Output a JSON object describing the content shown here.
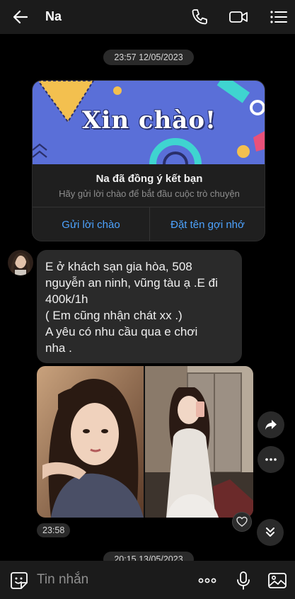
{
  "header": {
    "title": "Na",
    "icons": [
      "back-arrow-icon",
      "phone-icon",
      "video-call-icon",
      "menu-icon"
    ]
  },
  "timestamps": {
    "first": "23:57 12/05/2023",
    "second": "20:15 13/05/2023",
    "message_time": "23:58"
  },
  "friend_card": {
    "banner_text": "Xin chào!",
    "title": "Na đã đồng ý kết bạn",
    "subtitle": "Hãy gửi lời chào để bắt đầu cuộc trò chuyện",
    "send_greeting": "Gửi lời chào",
    "set_nickname": "Đặt tên gợi nhớ"
  },
  "message": {
    "lines": [
      " E ở khách sạn gia hòa, 508",
      "nguyễn an ninh, vũng tàu ạ .E đi",
      "400k/1h",
      "( Em cũng nhận chát xx .)",
      "A yêu có nhu cầu qua e chơi",
      "nha ."
    ]
  },
  "composer": {
    "placeholder": "Tin nhắn"
  },
  "colors": {
    "accent": "#4da3ff",
    "background": "#000000",
    "bubble": "#2a2a2a",
    "bar": "#1b1b1b"
  }
}
